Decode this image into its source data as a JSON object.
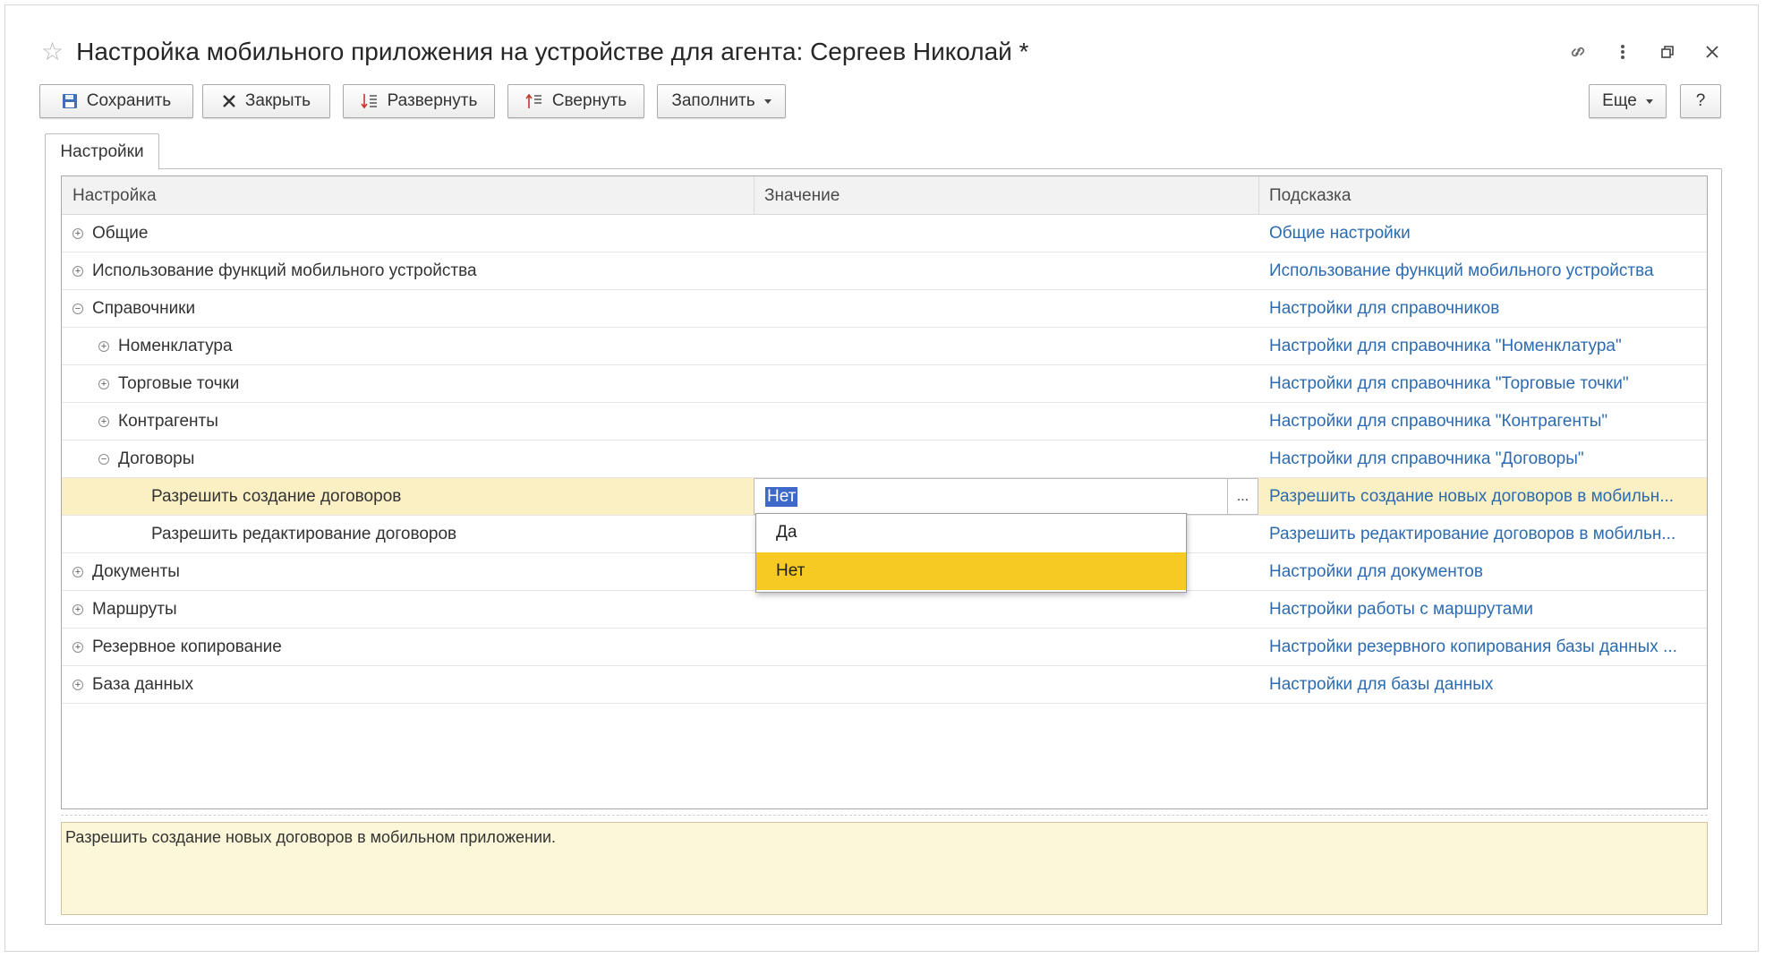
{
  "window": {
    "title": "Настройка мобильного приложения на устройстве для агента: Сергеев Николай *",
    "icons": [
      "star-icon",
      "link-icon",
      "more-icon",
      "restore-icon",
      "close-icon"
    ]
  },
  "toolbar": {
    "save": "Сохранить",
    "close": "Закрыть",
    "expand": "Развернуть",
    "collapse": "Свернуть",
    "fill": "Заполнить",
    "more": "Еще",
    "help": "?"
  },
  "tabs": [
    {
      "label": "Настройки",
      "active": true
    }
  ],
  "grid": {
    "columns": [
      "Настройка",
      "Значение",
      "Подсказка"
    ],
    "rows": [
      {
        "toggle": "⊕",
        "label": "Общие",
        "value": "",
        "hint": "Общие настройки"
      },
      {
        "toggle": "⊕",
        "label": "Использование функций мобильного устройства",
        "value": "",
        "hint": "Использование функций мобильного устройства"
      },
      {
        "toggle": "⊖",
        "label": "Справочники",
        "value": "",
        "hint": "Настройки для справочников"
      },
      {
        "toggle": "⊕",
        "label": "Номенклатура",
        "value": "",
        "hint": "Настройки для справочника \"Номенклатура\""
      },
      {
        "toggle": "⊕",
        "label": "Торговые точки",
        "value": "",
        "hint": "Настройки для справочника \"Торговые точки\""
      },
      {
        "toggle": "⊕",
        "label": "Контрагенты",
        "value": "",
        "hint": "Настройки для справочника \"Контрагенты\""
      },
      {
        "toggle": "⊖",
        "label": "Договоры",
        "value": "",
        "hint": "Настройки для справочника \"Договоры\""
      },
      {
        "toggle": "",
        "label": "Разрешить создание договоров",
        "value": "Нет",
        "hint": "Разрешить создание новых договоров в мобильн..."
      },
      {
        "toggle": "",
        "label": "Разрешить редактирование договоров",
        "value": "",
        "hint": "Разрешить редактирование договоров в мобильн..."
      },
      {
        "toggle": "⊕",
        "label": "Документы",
        "value": "",
        "hint": "Настройки для документов"
      },
      {
        "toggle": "⊕",
        "label": "Маршруты",
        "value": "",
        "hint": "Настройки работы с маршрутами"
      },
      {
        "toggle": "⊕",
        "label": "Резервное копирование",
        "value": "",
        "hint": "Настройки резервного копирования базы данных ..."
      },
      {
        "toggle": "⊕",
        "label": "База данных",
        "value": "",
        "hint": "Настройки для базы данных"
      }
    ],
    "edit_button": "..."
  },
  "dropdown": {
    "options": [
      "Да",
      "Нет"
    ],
    "selected": "Нет"
  },
  "hint_panel": {
    "text": "Разрешить создание новых договоров в мобильном приложении."
  },
  "colors": {
    "selected_row": "#fbefc4",
    "dropdown_active": "#f6c923",
    "hint_link": "#2d6bb0",
    "hint_panel_bg": "#fcf7d8"
  }
}
